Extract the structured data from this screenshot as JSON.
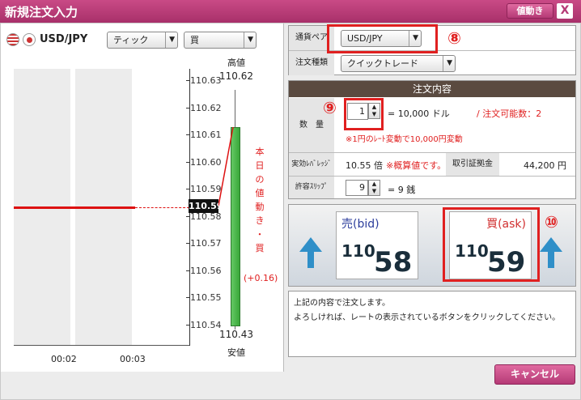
{
  "window": {
    "title": "新規注文入力",
    "price_btn": "値動き",
    "close": "X"
  },
  "chart": {
    "pair": "USD/JPY",
    "type_select": "ティック",
    "side_select": "買",
    "high_label": "高値",
    "high_value": "110.62",
    "low_label": "安値",
    "low_value": "110.43",
    "current_price": "110.59",
    "vertical_note": [
      "本",
      "日",
      "の",
      "値",
      "動",
      "き",
      "・",
      "買"
    ],
    "change": "(+0.16)",
    "time_labels": [
      "00:02",
      "00:03"
    ]
  },
  "chart_data": {
    "type": "line",
    "yticks": [
      "110.63",
      "110.62",
      "110.61",
      "110.60",
      "110.59",
      "110.58",
      "110.57",
      "110.56",
      "110.55",
      "110.54"
    ],
    "ylim": [
      110.54,
      110.63
    ],
    "series": [
      {
        "values": [
          110.59,
          110.59
        ]
      }
    ],
    "range_bar": {
      "low": 110.43,
      "high": 110.62
    }
  },
  "order": {
    "pair_label": "通貨ペア",
    "pair_value": "USD/JPY",
    "order_type_label": "注文種類",
    "order_type_value": "クイックトレード",
    "section_title": "注文内容",
    "qty_label": "数　量",
    "qty_value": "1",
    "qty_unit": "= 10,000 ドル",
    "qty_avail": "/ 注文可能数：2",
    "rate_note": "※1円のﾚｰﾄ変動で10,000円変動",
    "leverage_label": "実効ﾚﾊﾞﾚｯｼﾞ",
    "leverage_value": "10.55 倍",
    "leverage_note": "※概算値です。",
    "margin_label": "取引証拠金",
    "margin_value": "44,200 円",
    "slip_label": "許容ｽﾘｯﾌﾟ",
    "slip_value": "9",
    "slip_unit": "= 9 銭"
  },
  "rates": {
    "bid_label": "売(bid)",
    "bid_big": "110.",
    "bid_small": "58",
    "ask_label": "買(ask)",
    "ask_big": "110.",
    "ask_small": "59"
  },
  "message": {
    "line1": "上記の内容で注文します。",
    "line2": "よろしければ、レートの表示されているボタンをクリックしてください。"
  },
  "cancel": "キャンセル",
  "annotations": {
    "a8": "⑧",
    "a9": "⑨",
    "a10": "⑩"
  }
}
